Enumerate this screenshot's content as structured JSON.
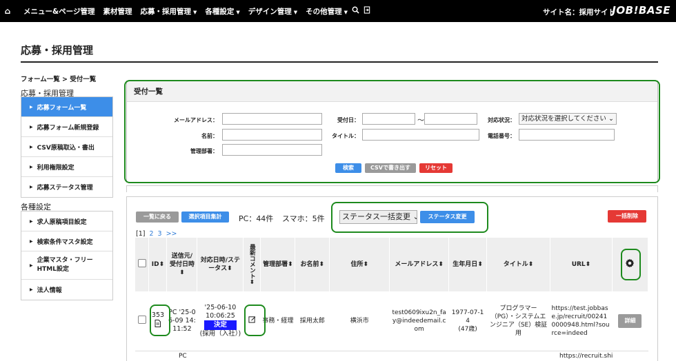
{
  "nav": {
    "items": [
      "メニュー&ページ管理",
      "素材管理",
      "応募・採用管理",
      "各種設定",
      "デザイン管理",
      "その他管理"
    ],
    "site_label": "サイト名：採用サイト",
    "logo": "JOB!BASE"
  },
  "page": {
    "title": "応募・採用管理",
    "breadcrumb": "フォーム一覧 > 受付一覧"
  },
  "sidebar": {
    "group1": "応募・採用管理",
    "items1": [
      "応募フォーム一覧",
      "応募フォーム新規登録",
      "CSV原稿取込・書出",
      "利用権限設定",
      "応募ステータス管理"
    ],
    "group2": "各種設定",
    "items2": [
      "求人原稿項目設定",
      "検索条件マスタ設定",
      "企業マスタ・フリーHTML設定",
      "法人情報"
    ]
  },
  "filter": {
    "title": "受付一覧",
    "email_label": "メールアドレス：",
    "date_label": "受付日：",
    "tilde": "〜",
    "status_label": "対応状況：",
    "status_placeholder": "対応状況を選択してください",
    "name_label": "名前：",
    "title_label": "タイトル：",
    "phone_label": "電話番号：",
    "dept_label": "管理部署：",
    "search_btn": "検索",
    "csv_btn": "CSVで書き出す",
    "reset_btn": "リセット"
  },
  "toolbar": {
    "back_btn": "一覧に戻る",
    "aggregate_btn": "選択項目集計",
    "pc_count": "PC：44件",
    "sp_count": "スマホ：5件",
    "bulk_select": "ステータス一括変更",
    "status_change_btn": "ステータス変更",
    "bulk_delete_btn": "一括削除"
  },
  "pager": {
    "current": "[1]",
    "pages": [
      "2",
      "3",
      ">>"
    ]
  },
  "table": {
    "headers": {
      "id": "ID",
      "source": "送信元/受付日時",
      "date_status": "対応日時/ステータス",
      "comment": "最新コメント",
      "dept": "管理部署",
      "name": "お名前",
      "address": "住所",
      "email": "メールアドレス",
      "birth": "生年月日",
      "title": "タイトル",
      "url": "URL"
    },
    "row": {
      "id": "353",
      "source": "PC '25-06-09 14:11:52",
      "date": "'25-06-10 10:06:25",
      "status": "決定",
      "status_note": "(採用（入社）)",
      "dept": "事務・経理",
      "name": "採用太郎",
      "address": "横浜市",
      "email": "test0609ixu2n_fay@indeedemail.com",
      "birth": "1977-07-14",
      "age": "(47歳)",
      "title": "プログラマー（PG）・システムエンジニア（SE）検証用",
      "url": "https://test.jobbase.jp/recruit/002410000948.html?source=indeed",
      "detail_btn": "詳細"
    },
    "next_row": {
      "source": "PC",
      "url": "https://recruit.shi"
    }
  },
  "colors": {
    "accent": "#3d8ee8",
    "highlight": "#1d8a1d",
    "danger": "#e53935",
    "status_badge": "#1a1aff"
  }
}
